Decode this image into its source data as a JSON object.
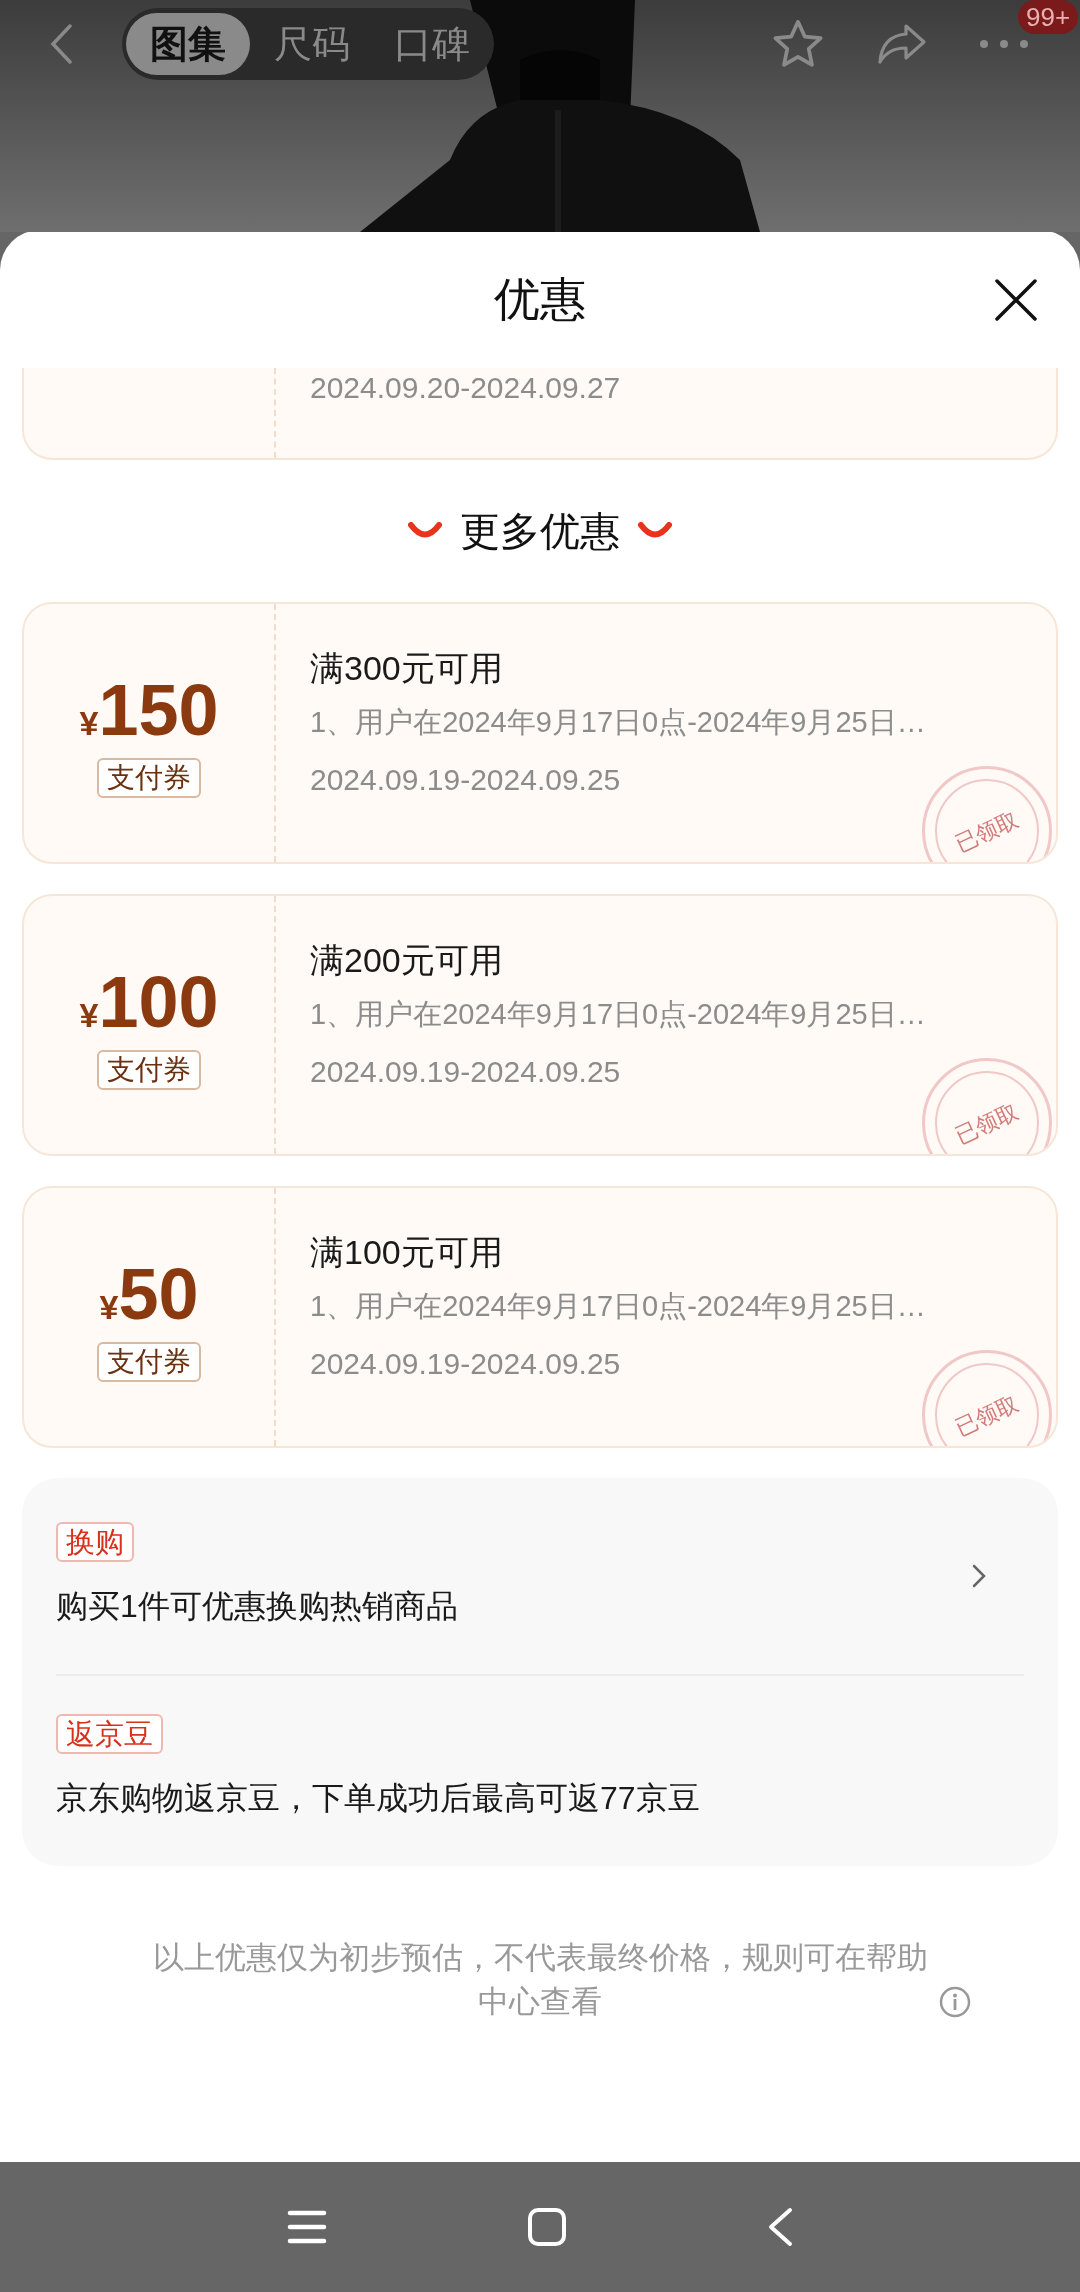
{
  "top_bar": {
    "tabs": [
      {
        "label": "图集",
        "selected": true
      },
      {
        "label": "尺码",
        "selected": false
      },
      {
        "label": "口碑",
        "selected": false
      }
    ],
    "badge": "99+"
  },
  "sheet": {
    "title": "优惠",
    "partial_coupon": {
      "validity": "2024.09.20-2024.09.27"
    },
    "section_title": "更多优惠",
    "coupons": [
      {
        "currency": "¥",
        "amount": "150",
        "type": "支付券",
        "title": "满300元可用",
        "description": "1、用户在2024年9月17日0点-2024年9月25日…",
        "validity": "2024.09.19-2024.09.25",
        "claimed": true,
        "stamp": "已领取"
      },
      {
        "currency": "¥",
        "amount": "100",
        "type": "支付券",
        "title": "满200元可用",
        "description": "1、用户在2024年9月17日0点-2024年9月25日…",
        "validity": "2024.09.19-2024.09.25",
        "claimed": true,
        "stamp": "已领取"
      },
      {
        "currency": "¥",
        "amount": "50",
        "type": "支付券",
        "title": "满100元可用",
        "description": "1、用户在2024年9月17日0点-2024年9月25日…",
        "validity": "2024.09.19-2024.09.25",
        "claimed": true,
        "stamp": "已领取"
      }
    ],
    "offers": [
      {
        "tag": "换购",
        "text": "购买1件可优惠换购热销商品",
        "has_arrow": true
      },
      {
        "tag": "返京豆",
        "text": "京东购物返京豆，下单成功后最高可返77京豆",
        "has_arrow": false
      }
    ],
    "disclaimer": "以上优惠仅为初步预估，不代表最终价格，规则可在帮助中心查看"
  }
}
